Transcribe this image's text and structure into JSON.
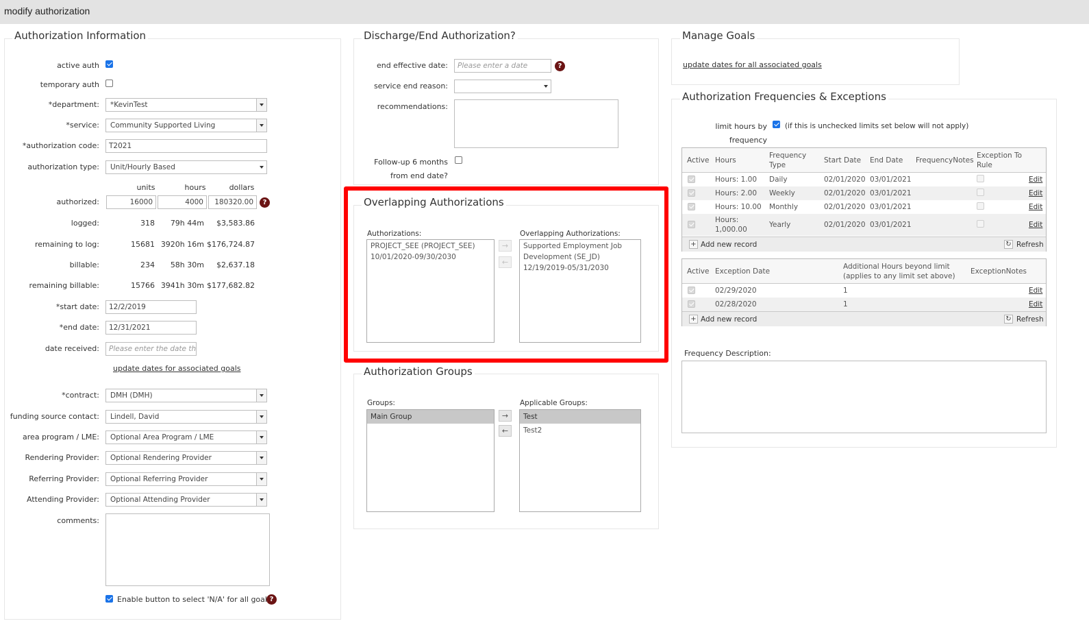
{
  "window": {
    "title": "modify authorization"
  },
  "auth_info": {
    "legend": "Authorization Information",
    "active_auth_label": "active auth",
    "temporary_auth_label": "temporary auth",
    "department_label": "*department:",
    "department_value": "*KevinTest",
    "service_label": "*service:",
    "service_value": "Community Supported Living",
    "auth_code_label": "*authorization code:",
    "auth_code_value": "T2021",
    "auth_type_label": "authorization type:",
    "auth_type_value": "Unit/Hourly Based",
    "col_units": "units",
    "col_hours": "hours",
    "col_dollars": "dollars",
    "authorized_label": "authorized:",
    "authorized_units": "16000",
    "authorized_hours": "4000",
    "authorized_dollars": "180320.00",
    "logged_label": "logged:",
    "logged_units": "318",
    "logged_hours": "79h 44m",
    "logged_dollars": "$3,583.86",
    "remaining_log_label": "remaining to log:",
    "remaining_log_units": "15681",
    "remaining_log_hours": "3920h 16m",
    "remaining_log_dollars": "$176,724.87",
    "billable_label": "billable:",
    "billable_units": "234",
    "billable_hours": "58h 30m",
    "billable_dollars": "$2,637.18",
    "remaining_billable_label": "remaining billable:",
    "remaining_billable_units": "15766",
    "remaining_billable_hours": "3941h 30m",
    "remaining_billable_dollars": "$177,682.82",
    "start_date_label": "*start date:",
    "start_date_value": "12/2/2019",
    "end_date_label": "*end date:",
    "end_date_value": "12/31/2021",
    "date_received_label": "date received:",
    "date_received_placeholder": "Please enter the date the au",
    "update_dates_link": "update dates for associated goals",
    "contract_label": "*contract:",
    "contract_value": "DMH (DMH)",
    "funding_label": "funding source contact:",
    "funding_value": "Lindell, David",
    "area_label": "area program / LME:",
    "area_value": "Optional Area Program / LME",
    "rendering_label": "Rendering Provider:",
    "rendering_value": "Optional Rendering Provider",
    "referring_label": "Referring Provider:",
    "referring_value": "Optional Referring Provider",
    "attending_label": "Attending Provider:",
    "attending_value": "Optional Attending Provider",
    "comments_label": "comments:",
    "enable_na_label": "Enable button to select 'N/A' for all goals"
  },
  "discharge": {
    "legend": "Discharge/End Authorization?",
    "end_effective_label": "end effective date:",
    "end_effective_placeholder": "Please enter a date",
    "service_end_label": "service end reason:",
    "recommendations_label": "recommendations:",
    "followup_label_1": "Follow-up 6 months",
    "followup_label_2": "from end date?"
  },
  "overlapping": {
    "legend": "Overlapping Authorizations",
    "left_label": "Authorizations:",
    "left_items": [
      "PROJECT_SEE (PROJECT_SEE) 10/01/2020-09/30/2030"
    ],
    "right_label": "Overlapping Authorizations:",
    "right_items": [
      "Supported Employment Job Development (SE_JD) 12/19/2019-05/31/2030"
    ]
  },
  "groups": {
    "legend": "Authorization Groups",
    "left_label": "Groups:",
    "left_items": [
      "Main Group"
    ],
    "right_label": "Applicable Groups:",
    "right_items": [
      "Test",
      "Test2"
    ]
  },
  "manage_goals": {
    "legend": "Manage Goals",
    "update_link": "update dates for all associated goals"
  },
  "frequencies": {
    "legend": "Authorization Frequencies & Exceptions",
    "limit_label_1": "limit hours by",
    "limit_label_2": "frequency",
    "limit_note": "(if this is unchecked limits set below will not apply)",
    "freq_headers": {
      "active": "Active",
      "hours": "Hours",
      "type_1": "Frequency",
      "type_2": "Type",
      "start": "Start Date",
      "end": "End Date",
      "notes": "FrequencyNotes",
      "exc_1": "Exception To",
      "exc_2": "Rule"
    },
    "freq_rows": [
      {
        "hours": "Hours: 1.00",
        "type": "Daily",
        "start": "02/01/2020",
        "end": "03/01/2021",
        "edit": "Edit"
      },
      {
        "hours": "Hours: 2.00",
        "type": "Weekly",
        "start": "02/01/2020",
        "end": "03/01/2021",
        "edit": "Edit"
      },
      {
        "hours": "Hours: 10.00",
        "type": "Monthly",
        "start": "02/01/2020",
        "end": "03/01/2021",
        "edit": "Edit"
      },
      {
        "hours_1": "Hours:",
        "hours_2": "1,000.00",
        "type": "Yearly",
        "start": "02/01/2020",
        "end": "03/01/2021",
        "edit": "Edit"
      }
    ],
    "add_new": "Add new record",
    "refresh": "Refresh",
    "exc_headers": {
      "active": "Active",
      "date": "Exception Date",
      "additional_1": "Additional Hours beyond limit",
      "additional_2": "(applies to any limit set above)",
      "notes": "ExceptionNotes"
    },
    "exc_rows": [
      {
        "date": "02/29/2020",
        "hours": "1",
        "edit": "Edit"
      },
      {
        "date": "02/28/2020",
        "hours": "1",
        "edit": "Edit"
      }
    ],
    "description_label": "Frequency Description:"
  },
  "colors": {
    "highlight": "#ff0000",
    "checkbox": "#1a73e8",
    "help": "#6b1414"
  }
}
